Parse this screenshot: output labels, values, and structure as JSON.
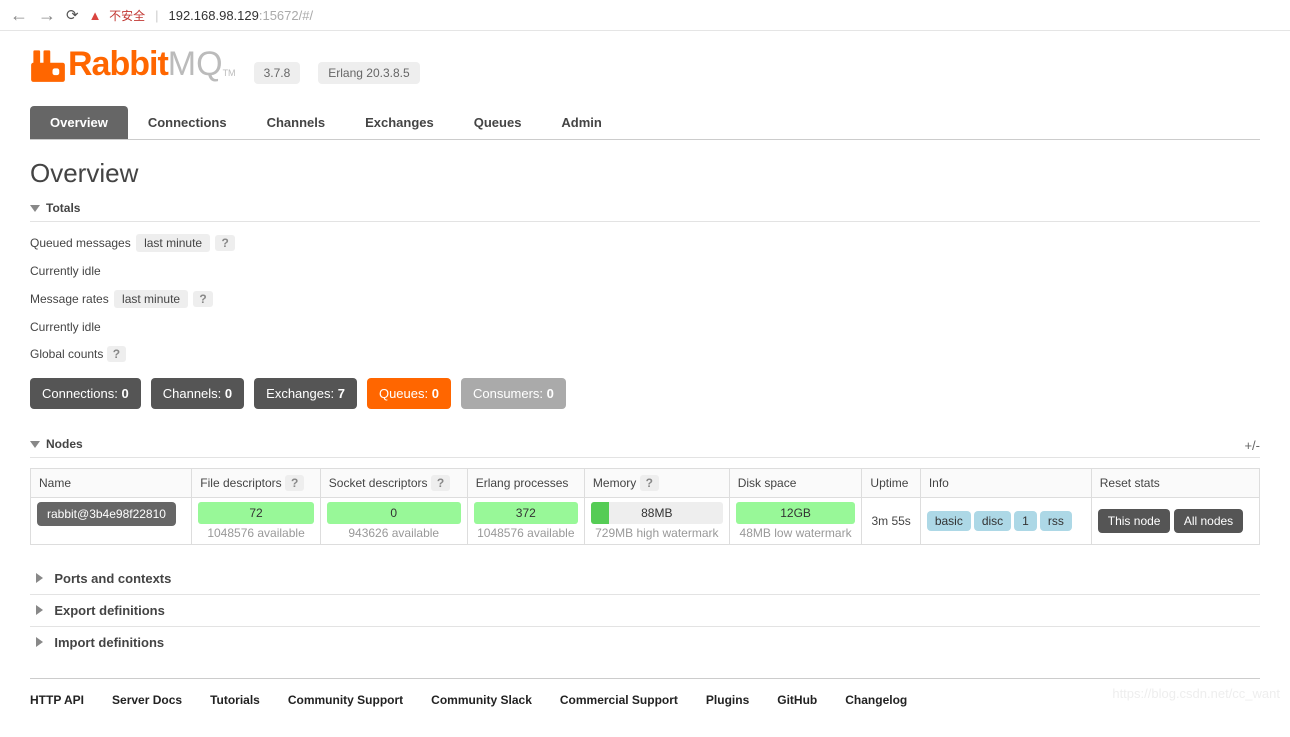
{
  "browser": {
    "insecure_label": "不安全",
    "url_host": "192.168.98.129",
    "url_port_path": ":15672/#/"
  },
  "header": {
    "brand_a": "Rabbit",
    "brand_b": "MQ",
    "tm": "TM",
    "version": "3.7.8",
    "erlang": "Erlang 20.3.8.5"
  },
  "tabs": [
    "Overview",
    "Connections",
    "Channels",
    "Exchanges",
    "Queues",
    "Admin"
  ],
  "page_title": "Overview",
  "sections": {
    "totals": "Totals",
    "nodes": "Nodes",
    "ports": "Ports and contexts",
    "export": "Export definitions",
    "import": "Import definitions"
  },
  "totals": {
    "queued_label": "Queued messages",
    "rates_label": "Message rates",
    "range": "last minute",
    "idle": "Currently idle",
    "global_counts": "Global counts",
    "counts": [
      {
        "label": "Connections:",
        "value": "0",
        "style": "dark"
      },
      {
        "label": "Channels:",
        "value": "0",
        "style": "dark"
      },
      {
        "label": "Exchanges:",
        "value": "7",
        "style": "dark"
      },
      {
        "label": "Queues:",
        "value": "0",
        "style": "orange"
      },
      {
        "label": "Consumers:",
        "value": "0",
        "style": "grey"
      }
    ]
  },
  "nodes_table": {
    "headers": [
      "Name",
      "File descriptors",
      "Socket descriptors",
      "Erlang processes",
      "Memory",
      "Disk space",
      "Uptime",
      "Info",
      "Reset stats"
    ],
    "plus": "+/-",
    "row": {
      "name": "rabbit@3b4e98f22810",
      "fd": {
        "used": "72",
        "avail": "1048576 available"
      },
      "sd": {
        "used": "0",
        "avail": "943626 available"
      },
      "ep": {
        "used": "372",
        "avail": "1048576 available"
      },
      "mem": {
        "used": "88MB",
        "hw": "729MB high watermark"
      },
      "disk": {
        "free": "12GB",
        "lw": "48MB low watermark"
      },
      "uptime": "3m 55s",
      "info": [
        "basic",
        "disc",
        "1",
        "rss"
      ],
      "reset": {
        "this": "This node",
        "all": "All nodes"
      }
    }
  },
  "footer": [
    "HTTP API",
    "Server Docs",
    "Tutorials",
    "Community Support",
    "Community Slack",
    "Commercial Support",
    "Plugins",
    "GitHub",
    "Changelog"
  ],
  "help": "?",
  "watermark": "https://blog.csdn.net/cc_want"
}
